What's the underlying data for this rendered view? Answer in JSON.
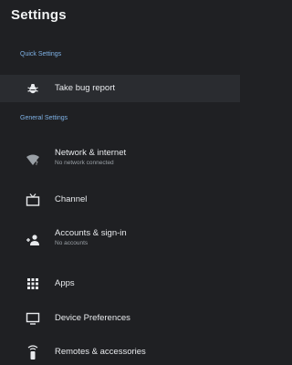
{
  "header": {
    "title": "Settings"
  },
  "sections": {
    "quick": {
      "title": "Quick Settings",
      "items": [
        {
          "label": "Take bug report",
          "icon": "bug-icon"
        }
      ]
    },
    "general": {
      "title": "General Settings",
      "items": [
        {
          "label": "Network & internet",
          "sublabel": "No network connected",
          "icon": "wifi-question-icon"
        },
        {
          "label": "Channel",
          "icon": "tv-icon"
        },
        {
          "label": "Accounts & sign-in",
          "sublabel": "No accounts",
          "icon": "add-account-icon"
        },
        {
          "label": "Apps",
          "icon": "apps-grid-icon"
        },
        {
          "label": "Device Preferences",
          "icon": "monitor-icon"
        },
        {
          "label": "Remotes & accessories",
          "icon": "remote-icon"
        }
      ]
    }
  },
  "colors": {
    "background": "#1f2023",
    "section_header": "#7fb2e6",
    "highlight": "#2a2c30"
  }
}
